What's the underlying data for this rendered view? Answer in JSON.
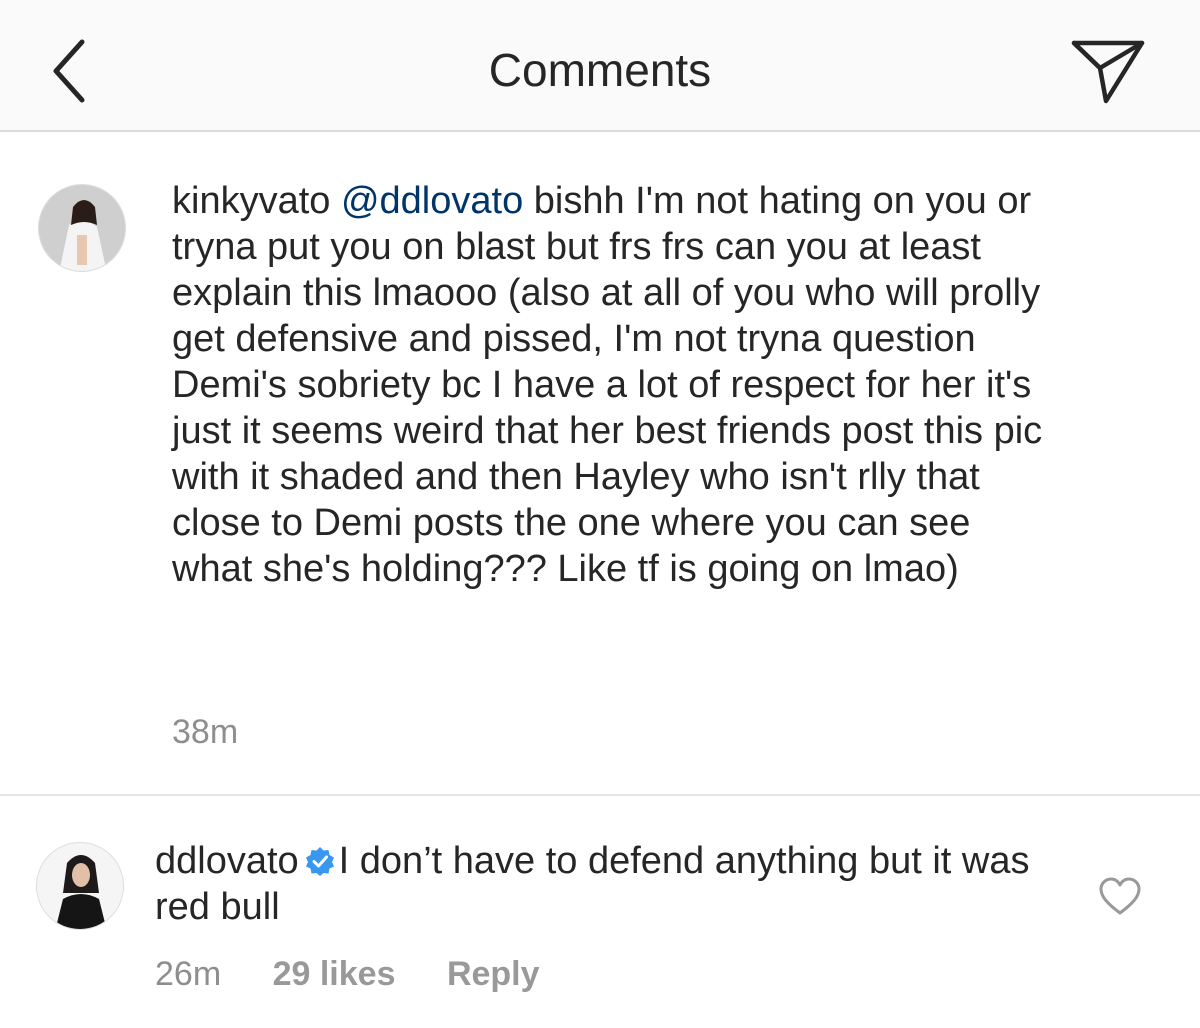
{
  "header": {
    "title": "Comments",
    "back_icon": "chevron-left-icon",
    "share_icon": "paper-plane-icon"
  },
  "comments": [
    {
      "username": "kinkyvato",
      "mention": "@ddlovato",
      "text": " bishh I'm not hating on you or tryna put you on blast but frs frs can you at least explain this lmaooo (also at all of you who will prolly get defensive and pissed, I'm not tryna question Demi's sobriety bc I have a lot of respect for her it's just it seems weird that her best friends post this pic with it shaded and then Hayley who isn't rlly that close to Demi posts the one where you can see what she's holding??? Like tf is going on lmao)",
      "time": "38m"
    },
    {
      "username": "ddlovato",
      "verified": true,
      "text": "I don’t have to defend anything but it was red bull",
      "time": "26m",
      "likes": "29 likes",
      "reply_label": "Reply"
    }
  ],
  "colors": {
    "mention": "#003569",
    "meta": "#8e8e8e",
    "verified": "#3897f0",
    "header_bg": "#fafafa"
  }
}
